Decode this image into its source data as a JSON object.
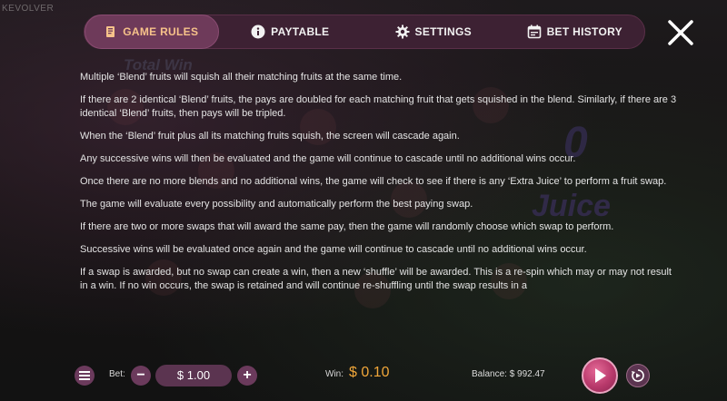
{
  "header": {
    "tabs": [
      {
        "label": "GAME RULES",
        "icon": "book-icon",
        "active": true
      },
      {
        "label": "PAYTABLE",
        "icon": "info-icon",
        "active": false
      },
      {
        "label": "SETTINGS",
        "icon": "gear-icon",
        "active": false
      },
      {
        "label": "BET HISTORY",
        "icon": "history-icon",
        "active": false
      }
    ],
    "close_icon": "close-icon"
  },
  "background": {
    "logo": "KEVOLVER",
    "total_win": "Total Win",
    "juice": "Juice",
    "counter": "0"
  },
  "rules": {
    "paragraphs": [
      "Multiple ‘Blend’ fruits will squish all their matching fruits at the same time.",
      "If there are 2 identical ‘Blend’ fruits, the pays are doubled for each matching fruit that gets squished in the blend. Similarly, if there are 3 identical ‘Blend’ fruits, then pays will be tripled.",
      "When the ‘Blend’ fruit plus all its matching fruits squish, the screen will cascade again.",
      "Any successive wins will then be evaluated and the game will continue to cascade until no additional wins occur.",
      "Once there are no more blends and no additional wins, the game will check to see if there is any ‘Extra Juice’ to perform a fruit swap.",
      "The game will evaluate every possibility and automatically perform the best paying swap.",
      "If there are two or more swaps that will award the same pay, then the game will randomly choose which swap to perform.",
      "Successive wins will be evaluated once again and the game will continue to cascade until no additional wins occur.",
      "If a swap is awarded, but no swap can create a win, then a new ‘shuffle’ will be awarded. This is a re-spin which may or may not result in a win. If no win occurs, the swap is retained and will continue re-shuffling until the swap results in a"
    ]
  },
  "footer": {
    "bet_label": "Bet:",
    "bet_value": "$ 1.00",
    "minus": "−",
    "plus": "+",
    "win_label": "Win:",
    "win_value": "$ 0.10",
    "balance": "Balance: $ 992.47"
  },
  "colors": {
    "accent": "#f6c28a",
    "tab_bar": "#3d2133",
    "active_tab": "#6e3a5a",
    "win": "#f0a63a",
    "spin": "#b8396b"
  }
}
